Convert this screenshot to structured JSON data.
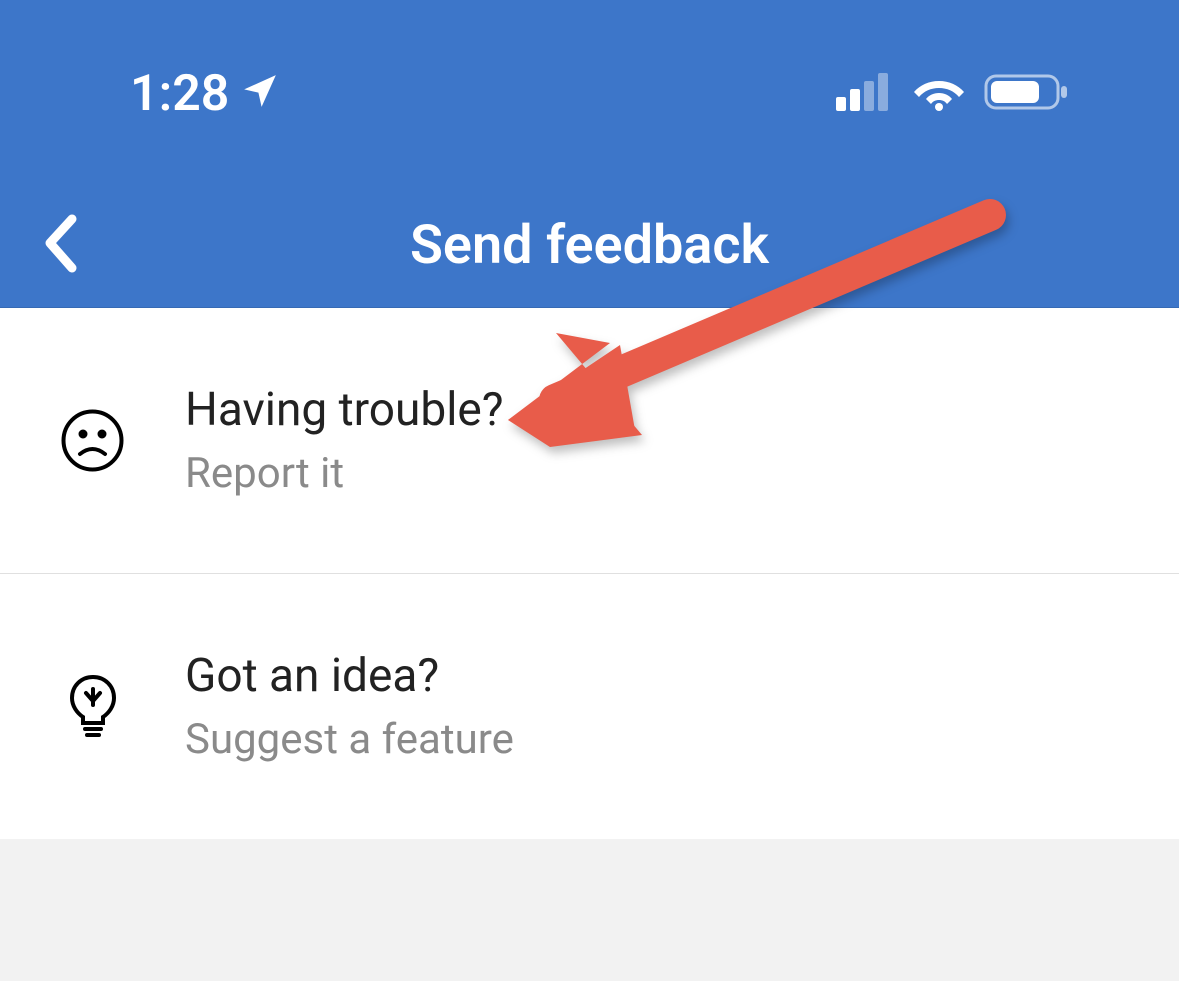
{
  "status_bar": {
    "time": "1:28"
  },
  "nav": {
    "title": "Send feedback"
  },
  "options": [
    {
      "title": "Having trouble?",
      "subtitle": "Report it"
    },
    {
      "title": "Got an idea?",
      "subtitle": "Suggest a feature"
    }
  ],
  "colors": {
    "header_bg": "#3d76c9",
    "arrow": "#e85c4a"
  }
}
